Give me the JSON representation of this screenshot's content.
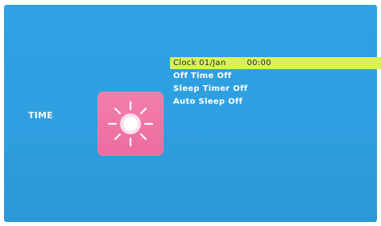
{
  "section": {
    "label": "TIME",
    "icon": "sun-icon"
  },
  "colors": {
    "screen_background": "#2ea2e4",
    "icon_tile": "#ee74a5",
    "highlight": "#d8f15a",
    "text": "#ffffff"
  },
  "menu": {
    "items": [
      {
        "label": "Clock 01/Jan",
        "value": "00:00",
        "selected": true
      },
      {
        "label": "Off Time Off",
        "selected": false
      },
      {
        "label": "Sleep Timer Off",
        "selected": false
      },
      {
        "label": "Auto Sleep Off",
        "selected": false
      }
    ]
  }
}
